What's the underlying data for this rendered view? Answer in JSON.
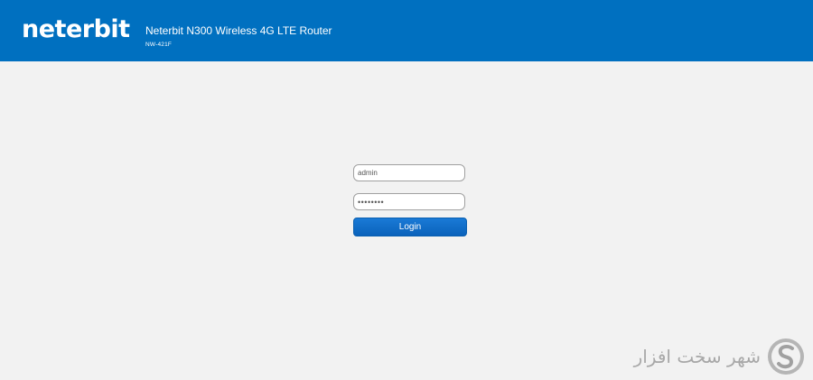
{
  "header": {
    "logo_text": "neterbit",
    "product_title": "Neterbit N300 Wireless 4G LTE Router",
    "model": "NW-421F",
    "background_color": "#0070c0"
  },
  "login": {
    "username_value": "admin",
    "password_value": "password",
    "button_label": "Login",
    "button_color": "#0a62bb"
  },
  "watermark": {
    "text": "شهر سخت افزار",
    "icon": "s-logo-icon"
  }
}
